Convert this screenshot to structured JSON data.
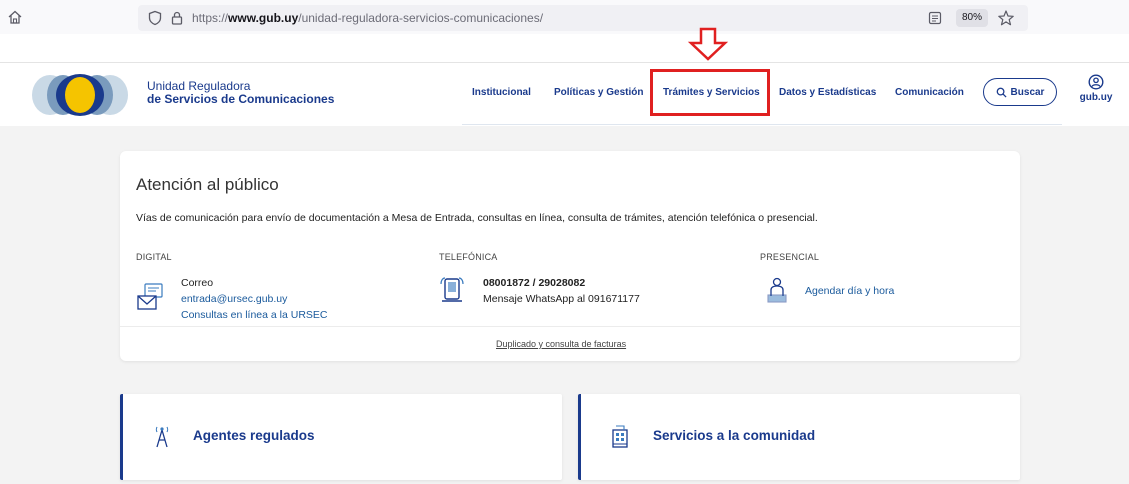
{
  "browser": {
    "url_prefix": "https://",
    "url_domain": "www.gub.uy",
    "url_path": "/unidad-reguladora-servicios-comunicaciones/",
    "zoom": "80%"
  },
  "header": {
    "org_line1": "Unidad Reguladora",
    "org_line2": "de Servicios de Comunicaciones",
    "nav": [
      "Institucional",
      "Políticas y Gestión",
      "Trámites y Servicios",
      "Datos y Estadísticas",
      "Comunicación"
    ],
    "search_label": "Buscar",
    "account_label": "gub.uy"
  },
  "atencion": {
    "title": "Atención al público",
    "description": "Vías de comunicación para envío de documentación a Mesa de Entrada, consultas en línea, consulta de trámites, atención telefónica o presencial.",
    "digital": {
      "label": "DIGITAL",
      "correo": "Correo",
      "email": "entrada@ursec.gub.uy",
      "consultas": "Consultas en línea a la URSEC"
    },
    "telefonica": {
      "label": "TELEFÓNICA",
      "numbers": "08001872 / 29028082",
      "whatsapp": "Mensaje WhatsApp al 091671177"
    },
    "presencial": {
      "label": "PRESENCIAL",
      "link": "Agendar día y hora"
    },
    "facturas_link": "Duplicado y consulta de facturas"
  },
  "cards": {
    "agentes": "Agentes regulados",
    "servicios": "Servicios a la comunidad"
  },
  "colors": {
    "brand_blue": "#1a3a8c",
    "link_blue": "#1a5a9c",
    "logo_yellow": "#f5c400",
    "annotation_red": "#e02020"
  },
  "icons": [
    "home-icon",
    "shield-icon",
    "lock-icon",
    "reader-view-icon",
    "bookmark-star-icon",
    "search-icon",
    "user-circle-icon",
    "mail-icon",
    "phone-icon",
    "person-desk-icon",
    "antenna-icon",
    "building-icon"
  ]
}
